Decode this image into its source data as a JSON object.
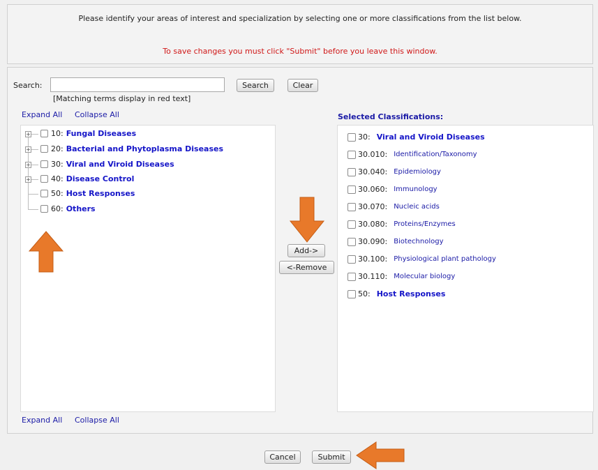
{
  "header": {
    "instruction": "Please identify your areas of interest and specialization by selecting one or more classifications from the list below.",
    "warning": "To save changes you must click \"Submit\" before you leave this window."
  },
  "search": {
    "label": "Search:",
    "value": "",
    "placeholder": "",
    "search_button": "Search",
    "clear_button": "Clear",
    "hint": "[Matching terms display in red text]"
  },
  "tree_links": {
    "expand_all": "Expand All",
    "collapse_all": "Collapse All"
  },
  "tree": [
    {
      "code": "10:",
      "label": "Fungal Diseases",
      "expandable": true,
      "checked": false
    },
    {
      "code": "20:",
      "label": "Bacterial and Phytoplasma Diseases",
      "expandable": true,
      "checked": false
    },
    {
      "code": "30:",
      "label": "Viral and Viroid Diseases",
      "expandable": true,
      "checked": false
    },
    {
      "code": "40:",
      "label": "Disease Control",
      "expandable": true,
      "checked": false
    },
    {
      "code": "50:",
      "label": "Host Responses",
      "expandable": false,
      "checked": false
    },
    {
      "code": "60:",
      "label": "Others",
      "expandable": false,
      "checked": false
    }
  ],
  "buttons": {
    "add": "Add->",
    "remove": "<-Remove",
    "cancel": "Cancel",
    "submit": "Submit"
  },
  "selected": {
    "title": "Selected Classifications:",
    "items": [
      {
        "code": "30:",
        "label": "Viral and Viroid Diseases",
        "level": "main"
      },
      {
        "code": "30.010:",
        "label": "Identification/Taxonomy",
        "level": "sub"
      },
      {
        "code": "30.040:",
        "label": "Epidemiology",
        "level": "sub"
      },
      {
        "code": "30.060:",
        "label": "Immunology",
        "level": "sub"
      },
      {
        "code": "30.070:",
        "label": "Nucleic acids",
        "level": "sub"
      },
      {
        "code": "30.080:",
        "label": "Proteins/Enzymes",
        "level": "sub"
      },
      {
        "code": "30.090:",
        "label": "Biotechnology",
        "level": "sub"
      },
      {
        "code": "30.100:",
        "label": "Physiological plant pathology",
        "level": "sub"
      },
      {
        "code": "30.110:",
        "label": "Molecular biology",
        "level": "sub"
      },
      {
        "code": "50:",
        "label": "Host Responses",
        "level": "main"
      }
    ]
  },
  "colors": {
    "link": "#1a1aa6",
    "tree_label": "#1515c8",
    "warning": "#d01818",
    "annotation_arrow": "#e8792a"
  }
}
